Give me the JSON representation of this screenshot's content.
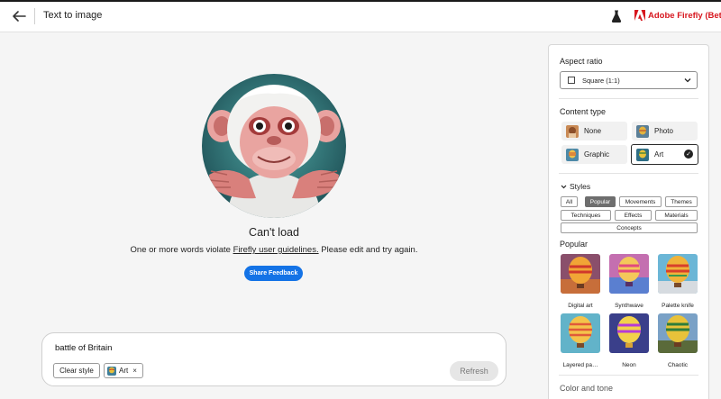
{
  "header": {
    "title": "Text to image",
    "brand": "Adobe Firefly (Beta)"
  },
  "main": {
    "heading": "Can't load",
    "message_before": "One or more words violate ",
    "message_link": "Firefly user guidelines.",
    "message_after": " Please edit and try again.",
    "share_button": "Share Feedback"
  },
  "prompt": {
    "text": "battle of Britain",
    "clear_style": "Clear style",
    "chip_label": "Art",
    "chip_remove": "×",
    "refresh": "Refresh"
  },
  "panel": {
    "aspect_ratio": {
      "label": "Aspect ratio",
      "selected": "Square (1:1)"
    },
    "content_type": {
      "label": "Content type",
      "options": [
        {
          "label": "None",
          "selected": false
        },
        {
          "label": "Photo",
          "selected": false
        },
        {
          "label": "Graphic",
          "selected": false
        },
        {
          "label": "Art",
          "selected": true
        }
      ]
    },
    "styles": {
      "label": "Styles",
      "tags": [
        {
          "label": "All",
          "active": false
        },
        {
          "label": "Popular",
          "active": true
        },
        {
          "label": "Movements",
          "active": false
        },
        {
          "label": "Themes",
          "active": false
        },
        {
          "label": "Techniques",
          "active": false
        },
        {
          "label": "Effects",
          "active": false
        },
        {
          "label": "Materials",
          "active": false
        },
        {
          "label": "Concepts",
          "active": false
        }
      ]
    },
    "popular": {
      "label": "Popular",
      "items": [
        {
          "label": "Digital art"
        },
        {
          "label": "Synthwave"
        },
        {
          "label": "Palette knife"
        },
        {
          "label": "Layered pa…"
        },
        {
          "label": "Neon"
        },
        {
          "label": "Chaotic"
        }
      ]
    },
    "next_section": "Color and tone"
  },
  "colors": {
    "accent": "#1473e6",
    "brand_red": "#d7161e"
  },
  "icons": [
    "arrow-left-icon",
    "flask-icon",
    "adobe-logo-icon",
    "chevron-down-icon",
    "checkmark-icon",
    "square-ratio-icon"
  ]
}
